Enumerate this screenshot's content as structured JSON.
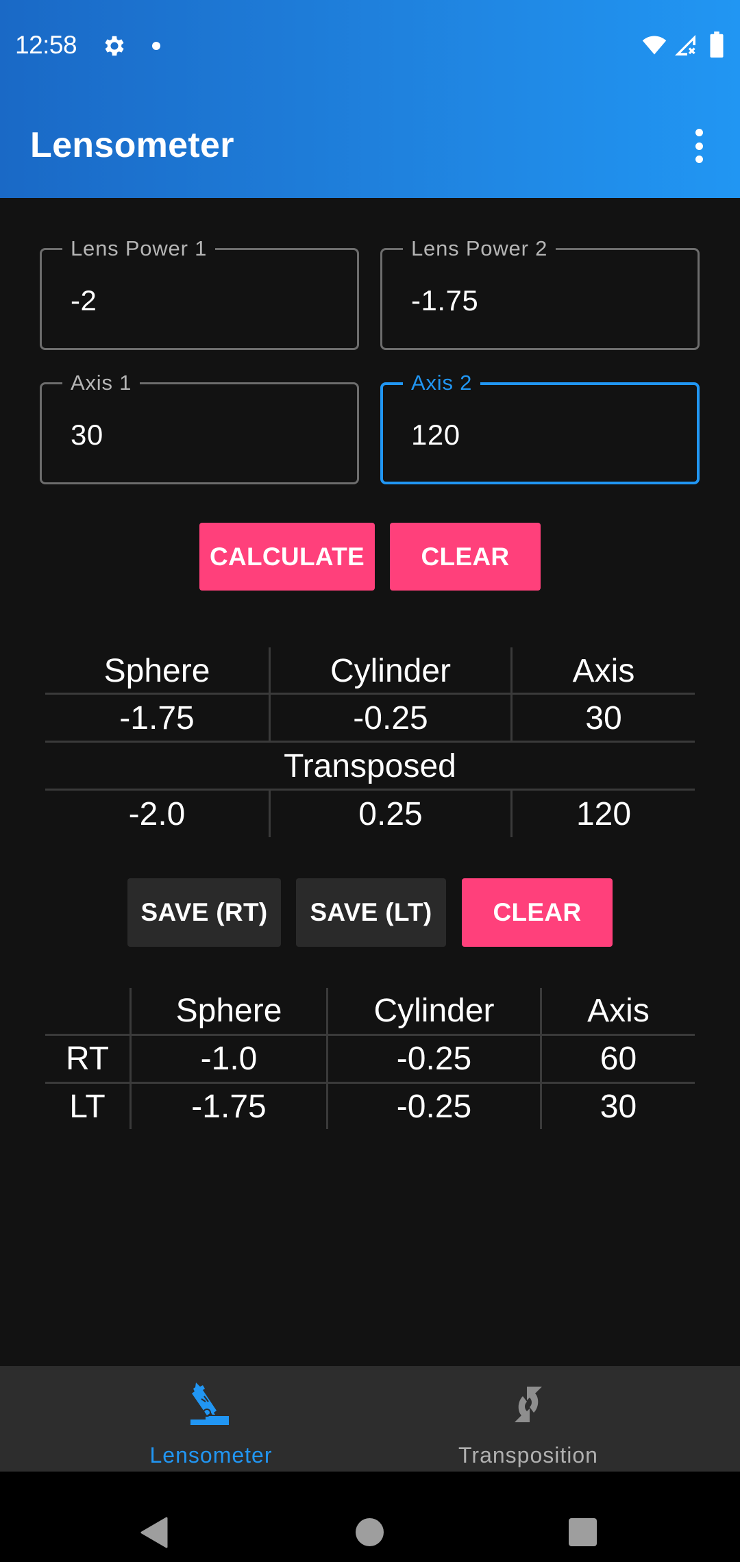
{
  "status_bar": {
    "time": "12:58",
    "icons": [
      "settings-gear-icon",
      "notification-dot-icon",
      "wifi-icon",
      "cell-signal-no-data-icon",
      "battery-icon"
    ]
  },
  "app_bar": {
    "title": "Lensometer",
    "menu_icon": "more-vert-icon"
  },
  "colors": {
    "accent": "#2196f3",
    "button_pink": "#ff407b",
    "background": "#121212",
    "nav_background": "#2d2d2d"
  },
  "inputs": {
    "lens_power_1": {
      "label": "Lens Power 1",
      "value": "-2"
    },
    "lens_power_2": {
      "label": "Lens Power 2",
      "value": "-1.75"
    },
    "axis_1": {
      "label": "Axis 1",
      "value": "30"
    },
    "axis_2": {
      "label": "Axis 2",
      "value": "120",
      "focused": true
    }
  },
  "actions": {
    "calculate_label": "CALCULATE",
    "clear_label": "CLEAR"
  },
  "result_table": {
    "headers": [
      "Sphere",
      "Cylinder",
      "Axis"
    ],
    "result": [
      "-1.75",
      "-0.25",
      "30"
    ],
    "transposed_label": "Transposed",
    "transposed": [
      "-2.0",
      "0.25",
      "120"
    ]
  },
  "save_actions": {
    "save_rt_label": "SAVE (RT)",
    "save_lt_label": "SAVE (LT)",
    "clear_label": "CLEAR"
  },
  "saved_table": {
    "headers": [
      "",
      "Sphere",
      "Cylinder",
      "Axis"
    ],
    "rows": [
      {
        "eye": "RT",
        "sphere": "-1.0",
        "cylinder": "-0.25",
        "axis": "60"
      },
      {
        "eye": "LT",
        "sphere": "-1.75",
        "cylinder": "-0.25",
        "axis": "30"
      }
    ]
  },
  "bottom_nav": {
    "items": [
      {
        "label": "Lensometer",
        "icon": "microscope-icon",
        "active": true
      },
      {
        "label": "Transposition",
        "icon": "swap-arrows-icon",
        "active": false
      }
    ]
  },
  "system_nav": {
    "buttons": [
      "back-icon",
      "home-icon",
      "recents-icon"
    ]
  }
}
